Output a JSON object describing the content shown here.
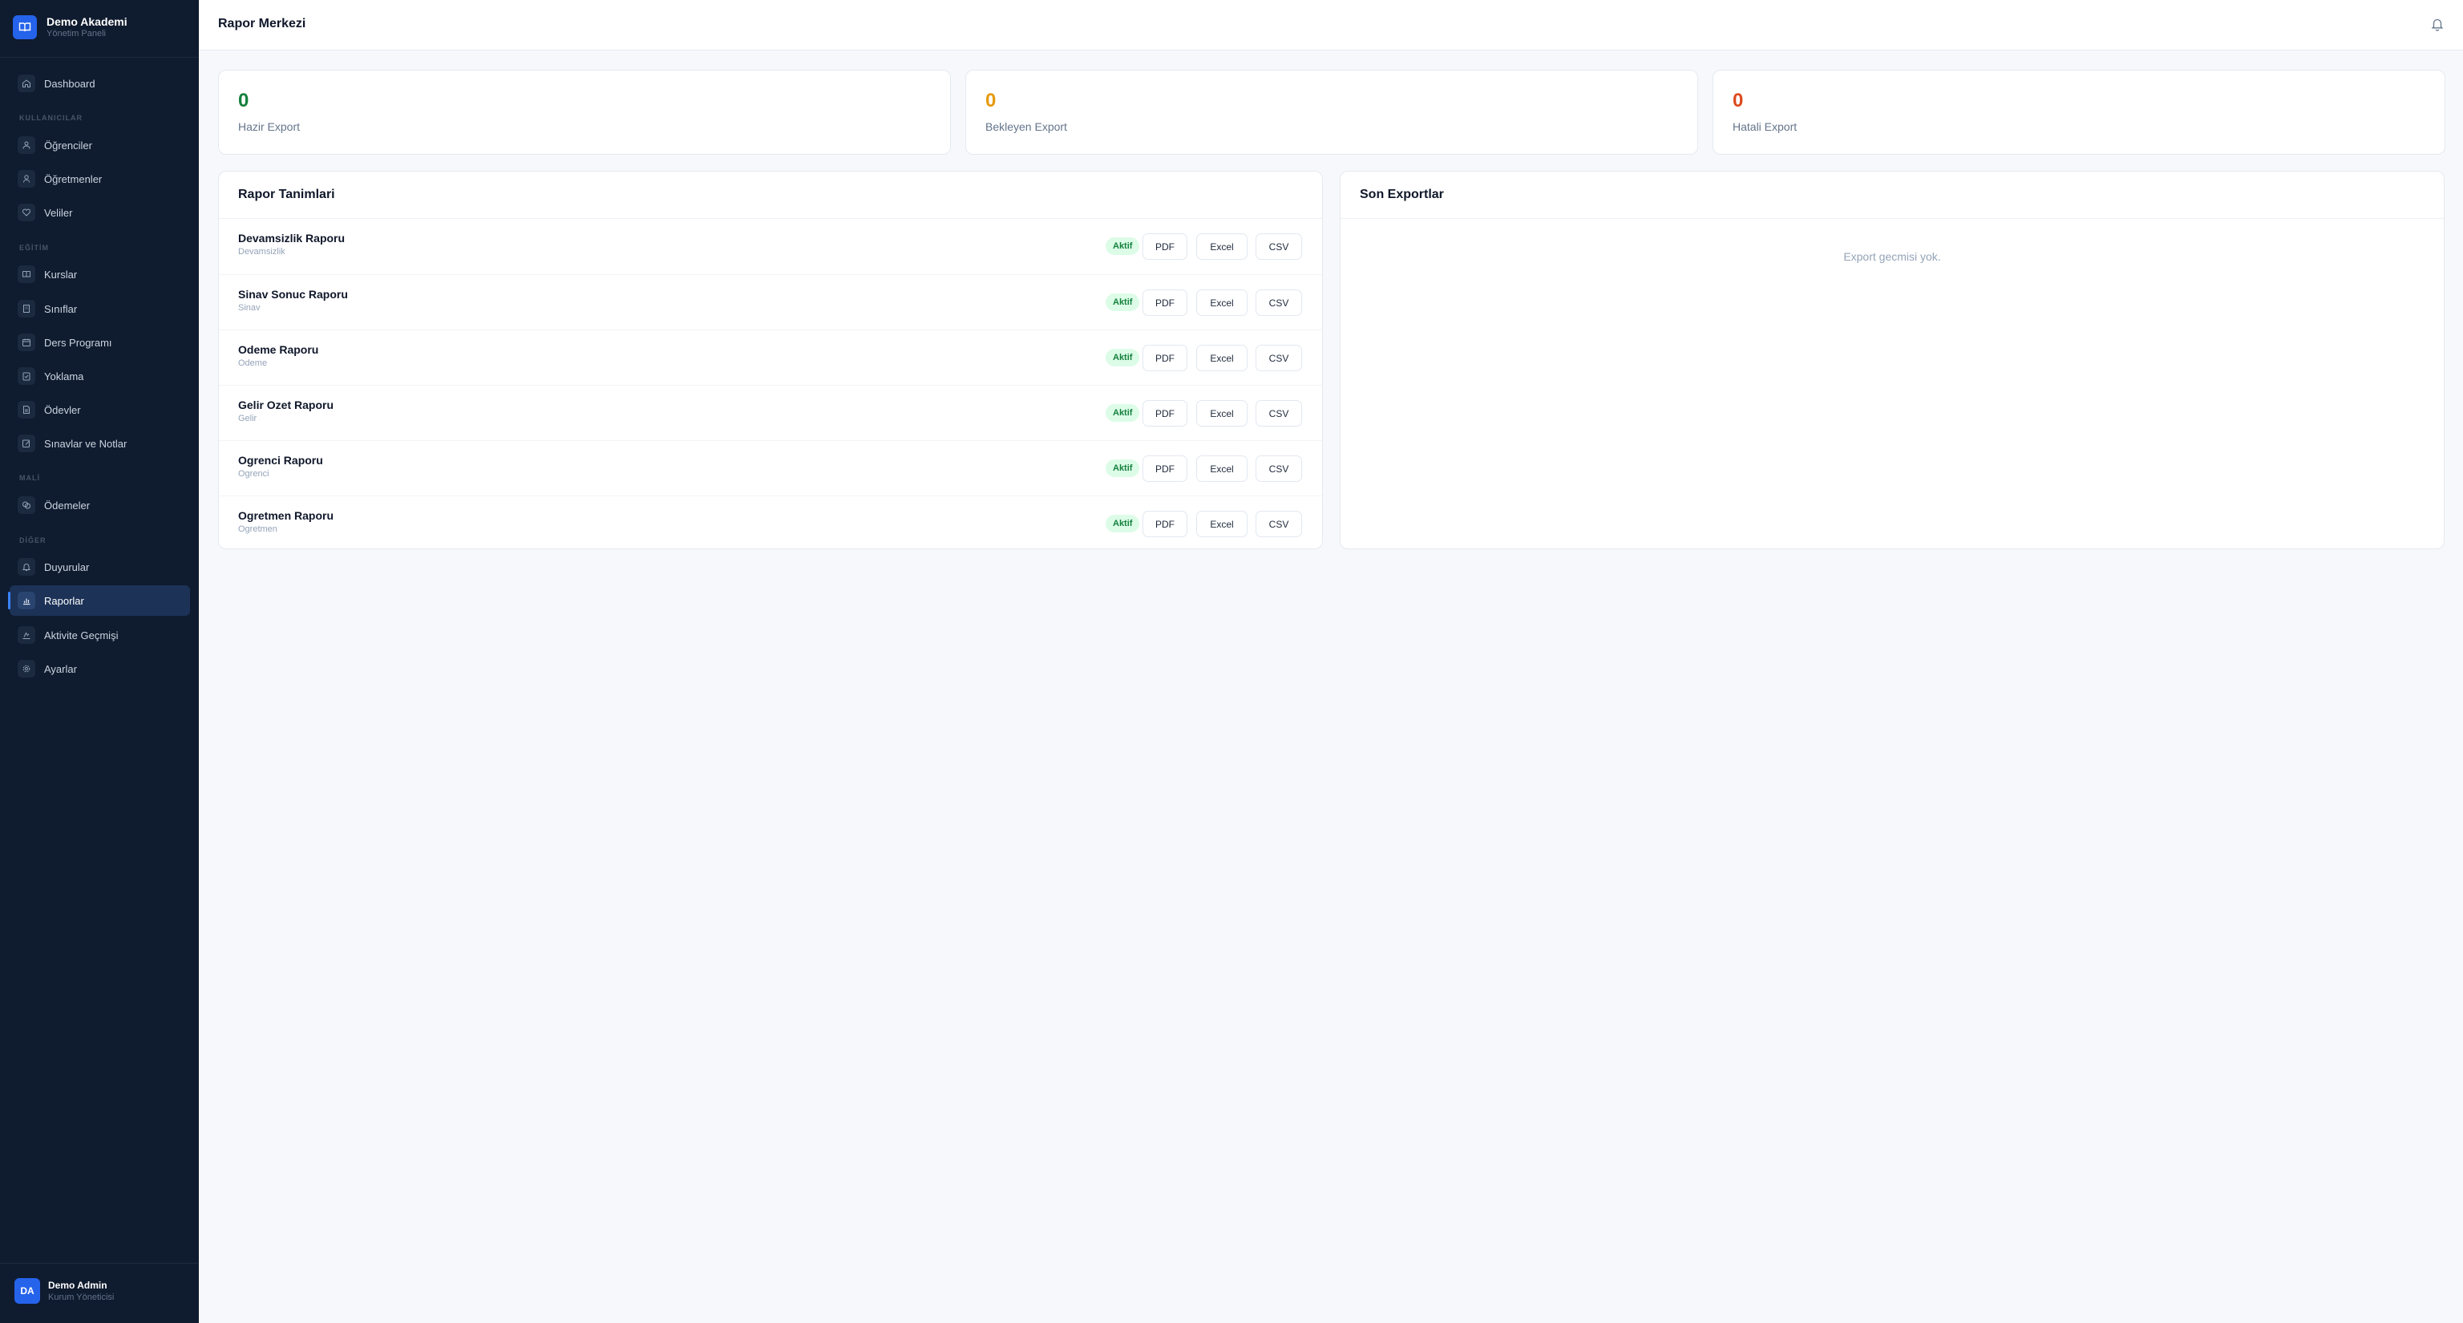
{
  "brand": {
    "title": "Demo Akademi",
    "subtitle": "Yönetim Paneli",
    "icon": "book-open-icon",
    "color": "#2563eb"
  },
  "sidebar": {
    "sections": {
      "users": "KULLANICILAR",
      "education": "EĞİTİM",
      "finance": "MALİ",
      "other": "DİĞER"
    },
    "items": [
      {
        "label": "Dashboard",
        "icon": "home-icon"
      },
      {
        "label": "Öğrenciler",
        "icon": "users-icon"
      },
      {
        "label": "Öğretmenler",
        "icon": "user-icon"
      },
      {
        "label": "Veliler",
        "icon": "heart-icon"
      },
      {
        "label": "Kurslar",
        "icon": "book-icon"
      },
      {
        "label": "Sınıflar",
        "icon": "building-icon"
      },
      {
        "label": "Ders Programı",
        "icon": "calendar-icon"
      },
      {
        "label": "Yoklama",
        "icon": "clipboard-check-icon"
      },
      {
        "label": "Ödevler",
        "icon": "file-text-icon"
      },
      {
        "label": "Sınavlar ve Notlar",
        "icon": "edit-icon"
      },
      {
        "label": "Ödemeler",
        "icon": "coins-icon"
      },
      {
        "label": "Duyurular",
        "icon": "bell-icon"
      },
      {
        "label": "Raporlar",
        "icon": "bar-chart-icon",
        "active": true
      },
      {
        "label": "Aktivite Geçmişi",
        "icon": "activity-icon"
      },
      {
        "label": "Ayarlar",
        "icon": "settings-icon"
      }
    ]
  },
  "user": {
    "initials": "DA",
    "name": "Demo Admin",
    "role": "Kurum Yöneticisi"
  },
  "header": {
    "title": "Rapor Merkezi",
    "bell_icon": "bell-icon"
  },
  "stats": [
    {
      "value": "0",
      "label": "Hazir Export",
      "color": "#15803d"
    },
    {
      "value": "0",
      "label": "Bekleyen Export",
      "color": "#e59a0e"
    },
    {
      "value": "0",
      "label": "Hatali Export",
      "color": "#dc4a1e"
    }
  ],
  "reports": {
    "title": "Rapor Tanimlari",
    "status_label": "Aktif",
    "actions": {
      "pdf": "PDF",
      "excel": "Excel",
      "csv": "CSV"
    },
    "items": [
      {
        "name": "Devamsizlik Raporu",
        "category": "Devamsizlik"
      },
      {
        "name": "Sinav Sonuc Raporu",
        "category": "Sinav"
      },
      {
        "name": "Odeme Raporu",
        "category": "Odeme"
      },
      {
        "name": "Gelir Ozet Raporu",
        "category": "Gelir"
      },
      {
        "name": "Ogrenci Raporu",
        "category": "Ogrenci"
      },
      {
        "name": "Ogretmen Raporu",
        "category": "Ogretmen"
      }
    ]
  },
  "exports": {
    "title": "Son Exportlar",
    "empty": "Export gecmisi yok."
  }
}
